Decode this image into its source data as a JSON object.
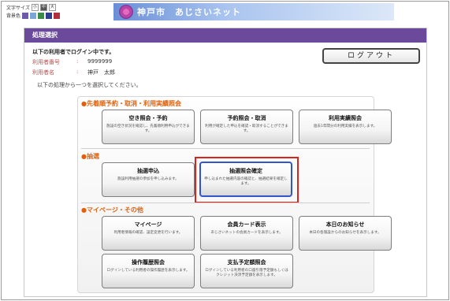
{
  "top": {
    "font_size_label": "文字サイズ",
    "font_sizes": [
      "小",
      "中",
      "大"
    ],
    "color_label": "背景色",
    "colors": [
      "#6f5aa8",
      "#7aa6d8",
      "#3a8a4a",
      "#2f3f8f",
      "#b03040"
    ]
  },
  "banner": {
    "city": "神戸市",
    "service": "あじさいネット"
  },
  "panel": {
    "title": "処理選択",
    "login_line": "以下の利用者でログイン中です。",
    "user_number_label": "利用者番号",
    "user_number_sep": ":",
    "user_number": "9999999",
    "user_name_label": "利用者名",
    "user_name_sep": ":",
    "user_name": "神戸　太郎",
    "instruction": "以下の処理から一つを選択してください。",
    "logout": "ログアウト"
  },
  "sections": {
    "reserve": "先着順予約・取消・利用実績照会",
    "lottery": "抽選",
    "mypage": "マイページ・その他"
  },
  "cards": {
    "vacancy": {
      "title": "空き照会・予約",
      "desc": "施設の空き状況を確認し、先着順利用申込ができます。"
    },
    "reservation": {
      "title": "予約照会・取消",
      "desc": "利用が確定した申込を確認・取消することができます。"
    },
    "usage": {
      "title": "利用実績照会",
      "desc": "過去1年間分の利用実績を表示します。"
    },
    "lottery_apply": {
      "title": "抽選申込",
      "desc": "施設利用抽選の参加を申し込みます。"
    },
    "lottery_confirm": {
      "title": "抽選照会確定",
      "desc": "申し込まれた抽選内容の確認と、抽選結果を確定します。"
    },
    "mypage": {
      "title": "マイページ",
      "desc": "利用者情報の確認、設定変更を行います。"
    },
    "member_card": {
      "title": "会員カード表示",
      "desc": "あじさいネットの会員カードを表示します。"
    },
    "news": {
      "title": "本日のお知らせ",
      "desc": "本日の各施設からのお知らせを表示します。"
    },
    "history": {
      "title": "操作履歴照会",
      "desc": "ログインしている利用者の操作履歴を表示します。"
    },
    "payment": {
      "title": "支払予定額照会",
      "desc": "ログインしている利用者の口座引落予定額もしくはクレジット決済予定額を表示します。"
    }
  }
}
